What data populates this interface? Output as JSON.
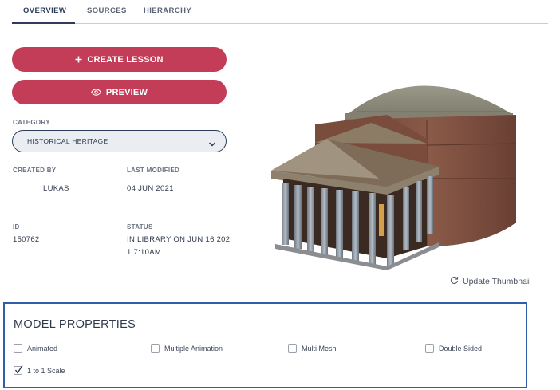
{
  "tabs": [
    {
      "label": "OVERVIEW",
      "active": true
    },
    {
      "label": "SOURCES",
      "active": false
    },
    {
      "label": "HIERARCHY",
      "active": false
    }
  ],
  "actions": {
    "create_lesson": "CREATE LESSON",
    "preview": "PREVIEW"
  },
  "category": {
    "label": "CATEGORY",
    "value": "HISTORICAL HERITAGE"
  },
  "meta": {
    "created_by_label": "CREATED BY",
    "created_by": "LUKAS",
    "last_modified_label": "LAST MODIFIED",
    "last_modified": "04 JUN 2021",
    "id_label": "ID",
    "id": "150762",
    "status_label": "STATUS",
    "status_line1": "IN LIBRARY ON JUN 16 202",
    "status_line2": "1 7:10AM"
  },
  "thumbnail": {
    "update_label": "Update Thumbnail"
  },
  "model_properties": {
    "title": "MODEL PROPERTIES",
    "options": [
      {
        "label": "Animated",
        "checked": false
      },
      {
        "label": "Multiple Animation",
        "checked": false
      },
      {
        "label": "Multi Mesh",
        "checked": false
      },
      {
        "label": "Double Sided",
        "checked": false
      },
      {
        "label": "1 to 1 Scale",
        "checked": true
      }
    ]
  },
  "colors": {
    "accent": "#c33d58",
    "navy": "#2c3c5c",
    "highlight_border": "#2e5fa8"
  }
}
